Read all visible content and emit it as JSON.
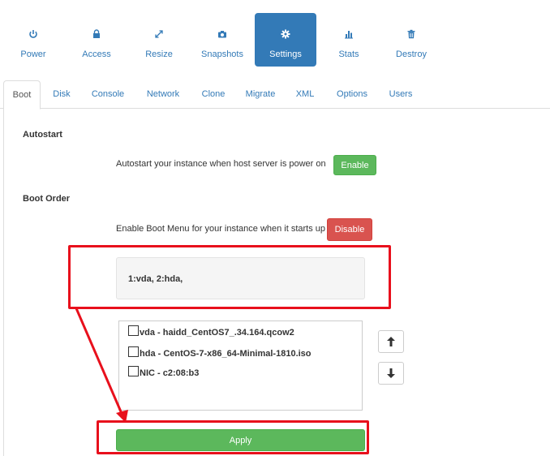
{
  "topnav": {
    "items": [
      {
        "label": "Power",
        "icon": "power-icon"
      },
      {
        "label": "Access",
        "icon": "lock-icon"
      },
      {
        "label": "Resize",
        "icon": "resize-icon"
      },
      {
        "label": "Snapshots",
        "icon": "camera-icon"
      },
      {
        "label": "Settings",
        "icon": "gear-icon",
        "active": true
      },
      {
        "label": "Stats",
        "icon": "bar-chart-icon"
      },
      {
        "label": "Destroy",
        "icon": "trash-icon"
      }
    ]
  },
  "tabs": {
    "items": [
      {
        "label": "Boot",
        "active": true
      },
      {
        "label": "Disk"
      },
      {
        "label": "Console"
      },
      {
        "label": "Network"
      },
      {
        "label": "Clone"
      },
      {
        "label": "Migrate"
      },
      {
        "label": "XML"
      },
      {
        "label": "Options"
      },
      {
        "label": "Users"
      }
    ]
  },
  "autostart": {
    "heading": "Autostart",
    "description": "Autostart your instance when host server is power on",
    "button_label": "Enable"
  },
  "boot_order": {
    "heading": "Boot Order",
    "menu_description": "Enable Boot Menu for your instance when it starts up",
    "menu_button_label": "Disable",
    "current_order": "1:vda, 2:hda,",
    "devices": [
      {
        "label": "vda - haidd_CentOS7_.34.164.qcow2",
        "checked": false
      },
      {
        "label": "hda - CentOS-7-x86_64-Minimal-1810.iso",
        "checked": false
      },
      {
        "label": "NIC - c2:08:b3",
        "checked": false
      }
    ],
    "apply_label": "Apply"
  },
  "colors": {
    "primary": "#337ab7",
    "success": "#5cb85c",
    "danger": "#d9534f",
    "annotation": "#e8101c"
  }
}
